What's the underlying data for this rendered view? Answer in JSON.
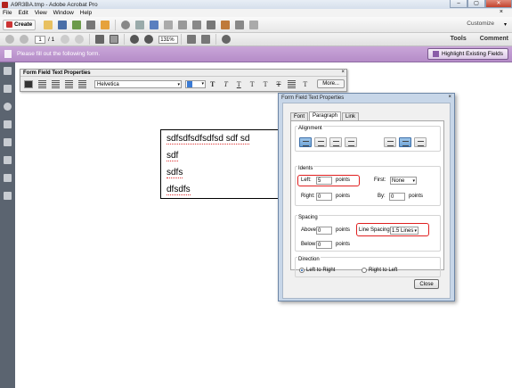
{
  "window": {
    "title": "A9R3BA.tmp - Adobe Acrobat Pro",
    "buttons": [
      "–",
      "▢",
      "✕"
    ]
  },
  "menubar": {
    "items": [
      "File",
      "Edit",
      "View",
      "Window",
      "Help"
    ],
    "close": "×"
  },
  "toolbar": {
    "create_label": "Create",
    "customize_label": "Customize",
    "customize_arrow": "▾"
  },
  "nav": {
    "page_current": "1",
    "page_total": "/ 1",
    "zoom": "131%",
    "tools_label": "Tools",
    "comment_label": "Comment"
  },
  "formbar": {
    "message": "Please fill out the following form.",
    "highlight_label": "Highlight Existing Fields"
  },
  "field_toolbar": {
    "title": "Form Field Text Properties",
    "close": "×",
    "font": "Helvetica",
    "glyphs": [
      "T",
      "T",
      "T",
      "T",
      "T",
      "T",
      "T"
    ],
    "more_label": "More..."
  },
  "textfield": {
    "lines": [
      "sdfsdfsdfsdfsd sdf sd",
      "sdf",
      "sdfs",
      "dfsdfs"
    ]
  },
  "dialog": {
    "title": "Form Field Text Properties",
    "close": "×",
    "tabs": [
      "Font",
      "Paragraph",
      "Link"
    ],
    "active_tab": "Paragraph",
    "alignment_title": "Alignment",
    "indents_title": "Idents",
    "left_label": "Left:",
    "left_value": "5",
    "left_unit": "points",
    "right_label": "Right:",
    "right_value": "0",
    "right_unit": "points",
    "first_label": "First:",
    "first_value": "None",
    "by_label": "By:",
    "by_value": "0",
    "by_unit": "points",
    "spacing_title": "Spacing",
    "above_label": "Above:",
    "above_value": "0",
    "above_unit": "points",
    "below_label": "Below:",
    "below_value": "0",
    "below_unit": "points",
    "line_spacing_label": "Line Spacing:",
    "line_spacing_value": "1.5 Lines",
    "direction_title": "Direction",
    "ltr_label": "Left to Right",
    "rtl_label": "Right to Left",
    "direction_selected": "Left to Right",
    "close_label": "Close"
  },
  "colors": {
    "form_bar": "#b58cc8",
    "annotation_red": "#e02020",
    "dialog_frame": "#c7d6e8",
    "left_panel": "#5b6470"
  }
}
